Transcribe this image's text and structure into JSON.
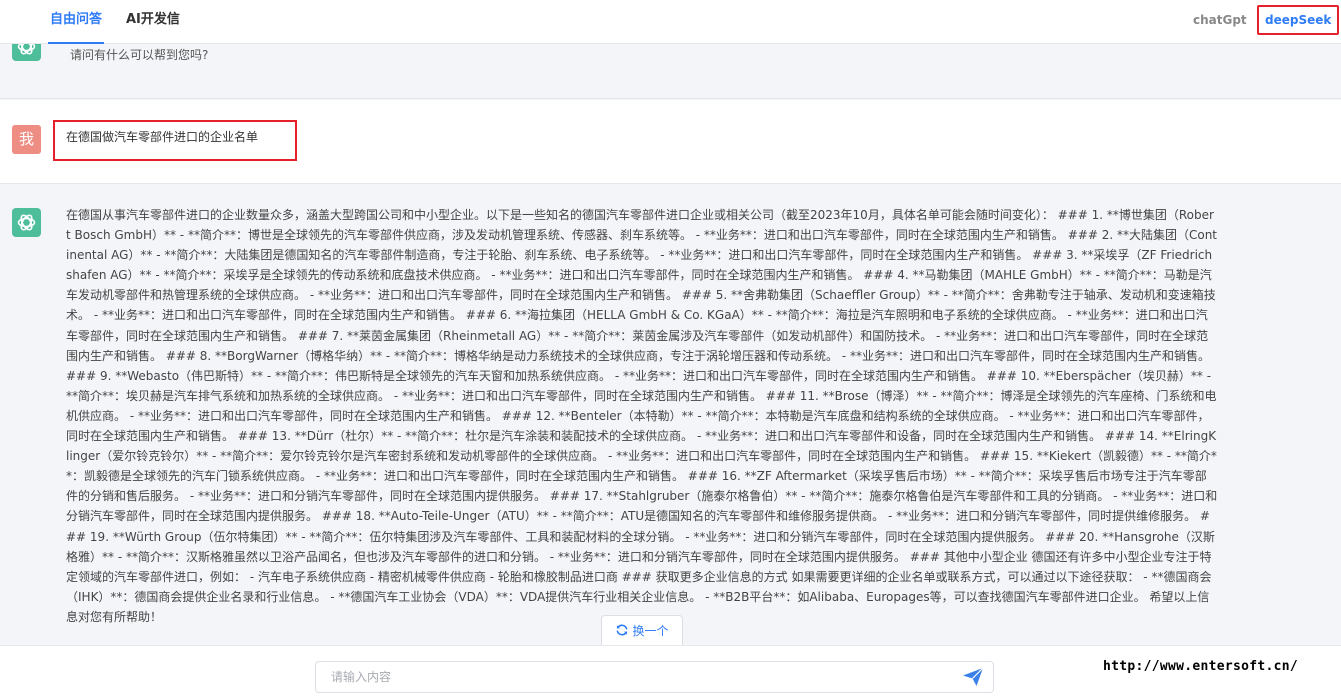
{
  "header": {
    "tabs": [
      {
        "label": "自由问答",
        "active": true
      },
      {
        "label": "AI开发信",
        "active": false
      }
    ],
    "models": [
      {
        "label": "chatGpt",
        "active": false
      },
      {
        "label": "deepSeek",
        "active": true
      }
    ]
  },
  "chat": {
    "greeting": "请问有什么可以帮到您吗?",
    "user_avatar": "我",
    "user_message": "在德国做汽车零部件进口的企业名单",
    "answer": "在德国从事汽车零部件进口的企业数量众多，涵盖大型跨国公司和中小型企业。以下是一些知名的德国汽车零部件进口企业或相关公司（截至2023年10月，具体名单可能会随时间变化）： ### 1. **博世集团（Robert Bosch GmbH）** - **简介**：博世是全球领先的汽车零部件供应商，涉及发动机管理系统、传感器、刹车系统等。 - **业务**：进口和出口汽车零部件，同时在全球范围内生产和销售。 ### 2. **大陆集团（Continental AG）** - **简介**：大陆集团是德国知名的汽车零部件制造商，专注于轮胎、刹车系统、电子系统等。 - **业务**：进口和出口汽车零部件，同时在全球范围内生产和销售。 ### 3. **采埃孚（ZF Friedrichshafen AG）** - **简介**：采埃孚是全球领先的传动系统和底盘技术供应商。 - **业务**：进口和出口汽车零部件，同时在全球范围内生产和销售。 ### 4. **马勒集团（MAHLE GmbH）** - **简介**：马勒是汽车发动机零部件和热管理系统的全球供应商。 - **业务**：进口和出口汽车零部件，同时在全球范围内生产和销售。 ### 5. **舍弗勒集团（Schaeffler Group）** - **简介**：舍弗勒专注于轴承、发动机和变速箱技术。 - **业务**：进口和出口汽车零部件，同时在全球范围内生产和销售。 ### 6. **海拉集团（HELLA GmbH & Co. KGaA）** - **简介**：海拉是汽车照明和电子系统的全球供应商。 - **业务**：进口和出口汽车零部件，同时在全球范围内生产和销售。 ### 7. **莱茵金属集团（Rheinmetall AG）** - **简介**：莱茵金属涉及汽车零部件（如发动机部件）和国防技术。 - **业务**：进口和出口汽车零部件，同时在全球范围内生产和销售。 ### 8. **BorgWarner（博格华纳）** - **简介**：博格华纳是动力系统技术的全球供应商，专注于涡轮增压器和传动系统。 - **业务**：进口和出口汽车零部件，同时在全球范围内生产和销售。 ### 9. **Webasto（伟巴斯特）** - **简介**：伟巴斯特是全球领先的汽车天窗和加热系统供应商。 - **业务**：进口和出口汽车零部件，同时在全球范围内生产和销售。 ### 10. **Eberspächer（埃贝赫）** - **简介**：埃贝赫是汽车排气系统和加热系统的全球供应商。 - **业务**：进口和出口汽车零部件，同时在全球范围内生产和销售。 ### 11. **Brose（博泽）** - **简介**：博泽是全球领先的汽车座椅、门系统和电机供应商。 - **业务**：进口和出口汽车零部件，同时在全球范围内生产和销售。 ### 12. **Benteler（本特勒）** - **简介**：本特勒是汽车底盘和结构系统的全球供应商。 - **业务**：进口和出口汽车零部件，同时在全球范围内生产和销售。 ### 13. **Dürr（杜尔）** - **简介**：杜尔是汽车涂装和装配技术的全球供应商。 - **业务**：进口和出口汽车零部件和设备，同时在全球范围内生产和销售。 ### 14. **ElringKlinger（爱尔铃克铃尔）** - **简介**：爱尔铃克铃尔是汽车密封系统和发动机零部件的全球供应商。 - **业务**：进口和出口汽车零部件，同时在全球范围内生产和销售。 ### 15. **Kiekert（凯毅德）** - **简介**：凯毅德是全球领先的汽车门锁系统供应商。 - **业务**：进口和出口汽车零部件，同时在全球范围内生产和销售。 ### 16. **ZF Aftermarket（采埃孚售后市场）** - **简介**：采埃孚售后市场专注于汽车零部件的分销和售后服务。 - **业务**：进口和分销汽车零部件，同时在全球范围内提供服务。 ### 17. **Stahlgruber（施泰尔格鲁伯）** - **简介**：施泰尔格鲁伯是汽车零部件和工具的分销商。 - **业务**：进口和分销汽车零部件，同时在全球范围内提供服务。 ### 18. **Auto-Teile-Unger（ATU）** - **简介**：ATU是德国知名的汽车零部件和维修服务提供商。 - **业务**：进口和分销汽车零部件，同时提供维修服务。 ### 19. **Würth Group（伍尔特集团）** - **简介**：伍尔特集团涉及汽车零部件、工具和装配材料的全球分销。 - **业务**：进口和分销汽车零部件，同时在全球范围内提供服务。 ### 20. **Hansgrohe（汉斯格雅）** - **简介**：汉斯格雅虽然以卫浴产品闻名，但也涉及汽车零部件的进口和分销。 - **业务**：进口和分销汽车零部件，同时在全球范围内提供服务。 ### 其他中小型企业 德国还有许多中小型企业专注于特定领域的汽车零部件进口，例如： - 汽车电子系统供应商 - 精密机械零件供应商 - 轮胎和橡胶制品进口商 ### 获取更多企业信息的方式 如果需要更详细的企业名单或联系方式，可以通过以下途径获取： - **德国商会（IHK）**：德国商会提供企业名录和行业信息。 - **德国汽车工业协会（VDA）**：VDA提供汽车行业相关企业信息。 - **B2B平台**：如Alibaba、Europages等，可以查找德国汽车零部件进口企业。 希望以上信息对您有所帮助！",
    "regenerate_label": "换一个"
  },
  "input": {
    "placeholder": "请输入内容",
    "value": ""
  },
  "watermark": "http://www.entersoft.cn/",
  "colors": {
    "accent": "#2f7cf6",
    "highlight_border": "#e5202a",
    "bot_avatar": "#4dbd9a",
    "user_avatar": "#ee8d84",
    "chat_background": "#f4f5f9"
  },
  "icons": {
    "bot_avatar": "openai-logo-icon",
    "regenerate": "refresh-icon",
    "send": "paper-plane-icon"
  }
}
